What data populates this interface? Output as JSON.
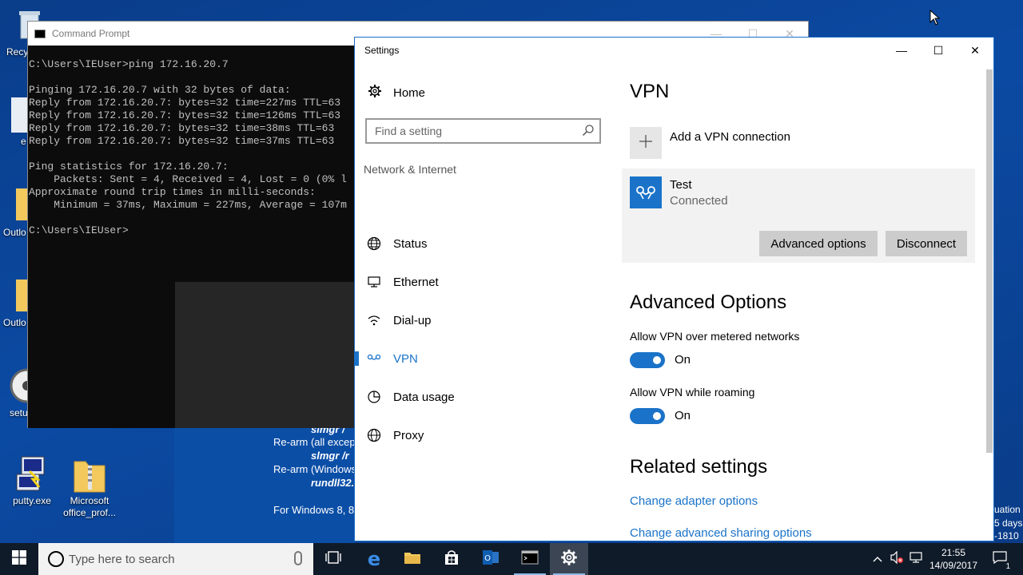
{
  "desktop": {
    "icons": [
      {
        "label": "putty.exe"
      },
      {
        "label": "Microsoft office_prof..."
      }
    ],
    "partial_labels": [
      "Recyc",
      "e",
      "Outlo",
      "Outlo",
      "setu"
    ],
    "right_edge_text": [
      "uation",
      "5 days",
      "-1810"
    ]
  },
  "bg_window_text": {
    "line1": "slmgr /",
    "line2": "Re-arm (all excep",
    "line3": "slmgr /r",
    "line4": "Re-arm (Windows",
    "line5": "rundll32.",
    "line6": "For Windows 8, 8"
  },
  "cmd": {
    "title": "Command Prompt",
    "lines": [
      "C:\\Users\\IEUser>ping 172.16.20.7",
      "",
      "Pinging 172.16.20.7 with 32 bytes of data:",
      "Reply from 172.16.20.7: bytes=32 time=227ms TTL=63",
      "Reply from 172.16.20.7: bytes=32 time=126ms TTL=63",
      "Reply from 172.16.20.7: bytes=32 time=38ms TTL=63",
      "Reply from 172.16.20.7: bytes=32 time=37ms TTL=63",
      "",
      "Ping statistics for 172.16.20.7:",
      "    Packets: Sent = 4, Received = 4, Lost = 0 (0% l",
      "Approximate round trip times in milli-seconds:",
      "    Minimum = 37ms, Maximum = 227ms, Average = 107m",
      "",
      "C:\\Users\\IEUser>"
    ]
  },
  "settings": {
    "title": "Settings",
    "nav": {
      "home": "Home",
      "search_placeholder": "Find a setting",
      "section": "Network & Internet",
      "items": [
        {
          "label": "Status",
          "icon": "globe-icon"
        },
        {
          "label": "Ethernet",
          "icon": "ethernet-icon"
        },
        {
          "label": "Dial-up",
          "icon": "dialup-icon"
        },
        {
          "label": "VPN",
          "icon": "vpn-icon",
          "active": true
        },
        {
          "label": "Data usage",
          "icon": "data-usage-icon"
        },
        {
          "label": "Proxy",
          "icon": "proxy-globe-icon"
        }
      ]
    },
    "content": {
      "heading": "VPN",
      "add_connection": "Add a VPN connection",
      "connection": {
        "name": "Test",
        "status": "Connected",
        "advanced_button": "Advanced options",
        "disconnect_button": "Disconnect"
      },
      "advanced_heading": "Advanced Options",
      "metered_label": "Allow VPN over metered networks",
      "metered_state": "On",
      "roaming_label": "Allow VPN while roaming",
      "roaming_state": "On",
      "related_heading": "Related settings",
      "link_adapter": "Change adapter options",
      "link_sharing": "Change advanced sharing options"
    }
  },
  "taskbar": {
    "search_placeholder": "Type here to search",
    "time": "21:55",
    "date": "14/09/2017",
    "notification_count": "1",
    "accent": "#1a73c9"
  }
}
